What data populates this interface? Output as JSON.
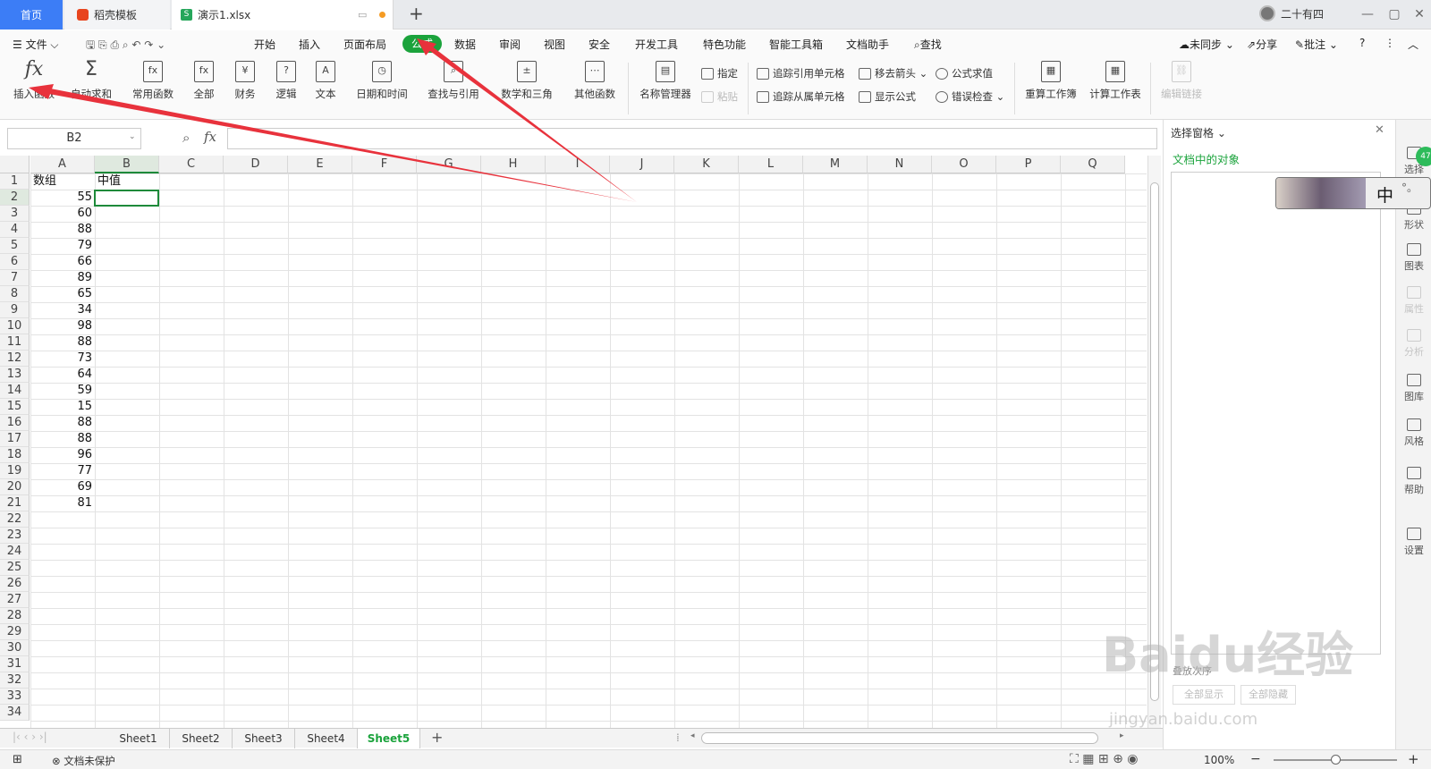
{
  "tabs": {
    "home": "首页",
    "template": "稻壳模板",
    "file": "演示1.xlsx"
  },
  "user": {
    "name": "二十有四"
  },
  "menu": {
    "file": "文件",
    "start": "开始",
    "insert": "插入",
    "layout": "页面布局",
    "formula": "公式",
    "data": "数据",
    "review": "审阅",
    "view": "视图",
    "security": "安全",
    "dev": "开发工具",
    "special": "特色功能",
    "smart": "智能工具箱",
    "doc_helper": "文档助手",
    "search": "查找",
    "unsync": "未同步",
    "share": "分享",
    "comment": "批注"
  },
  "ribbon": {
    "insert_fn": "插入函数",
    "autosum": "自动求和",
    "common": "常用函数",
    "all": "全部",
    "finance": "财务",
    "logic": "逻辑",
    "text": "文本",
    "datetime": "日期和时间",
    "lookup": "查找与引用",
    "math": "数学和三角",
    "other": "其他函数",
    "name_mgr": "名称管理器",
    "assign": "指定",
    "paste": "粘贴",
    "trace_prec": "追踪引用单元格",
    "trace_dep": "追踪从属单元格",
    "remove_arrows": "移去箭头",
    "show_formula": "显示公式",
    "eval": "公式求值",
    "err_check": "错误检查",
    "recalc_wb": "重算工作簿",
    "calc_sheet": "计算工作表",
    "edit_links": "编辑链接"
  },
  "formula_bar": {
    "namebox": "B2",
    "fx": "fx",
    "value": ""
  },
  "columns": [
    "A",
    "B",
    "C",
    "D",
    "E",
    "F",
    "G",
    "H",
    "I",
    "J",
    "K",
    "L",
    "M",
    "N",
    "O",
    "P",
    "Q"
  ],
  "rows": [
    "1",
    "2",
    "3",
    "4",
    "5",
    "6",
    "7",
    "8",
    "9",
    "10",
    "11",
    "12",
    "13",
    "14",
    "15",
    "16",
    "17",
    "18",
    "19",
    "20",
    "21",
    "22",
    "23",
    "24",
    "25",
    "26",
    "27",
    "28",
    "29",
    "30",
    "31",
    "32",
    "33",
    "34"
  ],
  "cells": {
    "A1": "数组",
    "B1": "中值",
    "A": [
      "55",
      "60",
      "88",
      "79",
      "66",
      "89",
      "65",
      "34",
      "98",
      "88",
      "73",
      "64",
      "59",
      "15",
      "88",
      "88",
      "96",
      "77",
      "69",
      "81"
    ]
  },
  "sheets": [
    "Sheet1",
    "Sheet2",
    "Sheet3",
    "Sheet4",
    "Sheet5"
  ],
  "active_sheet": "Sheet5",
  "panel": {
    "title": "选择窗格",
    "subtitle": "文档中的对象",
    "sort": "叠放次序",
    "show_all": "全部显示",
    "hide_all": "全部隐藏"
  },
  "right_strip": [
    "选择",
    "形状",
    "图表",
    "属性",
    "分析",
    "图库",
    "风格",
    "帮助",
    "设置"
  ],
  "status": {
    "protect": "文档未保护",
    "zoom": "100%"
  },
  "sticker_char": "中",
  "badge": "47",
  "watermark": {
    "main": "Baidu经验",
    "url": "jingyan.baidu.com"
  },
  "colors": {
    "accent": "#1ba33c",
    "tab_blue": "#3c7df6",
    "arrow": "#e8323c"
  }
}
